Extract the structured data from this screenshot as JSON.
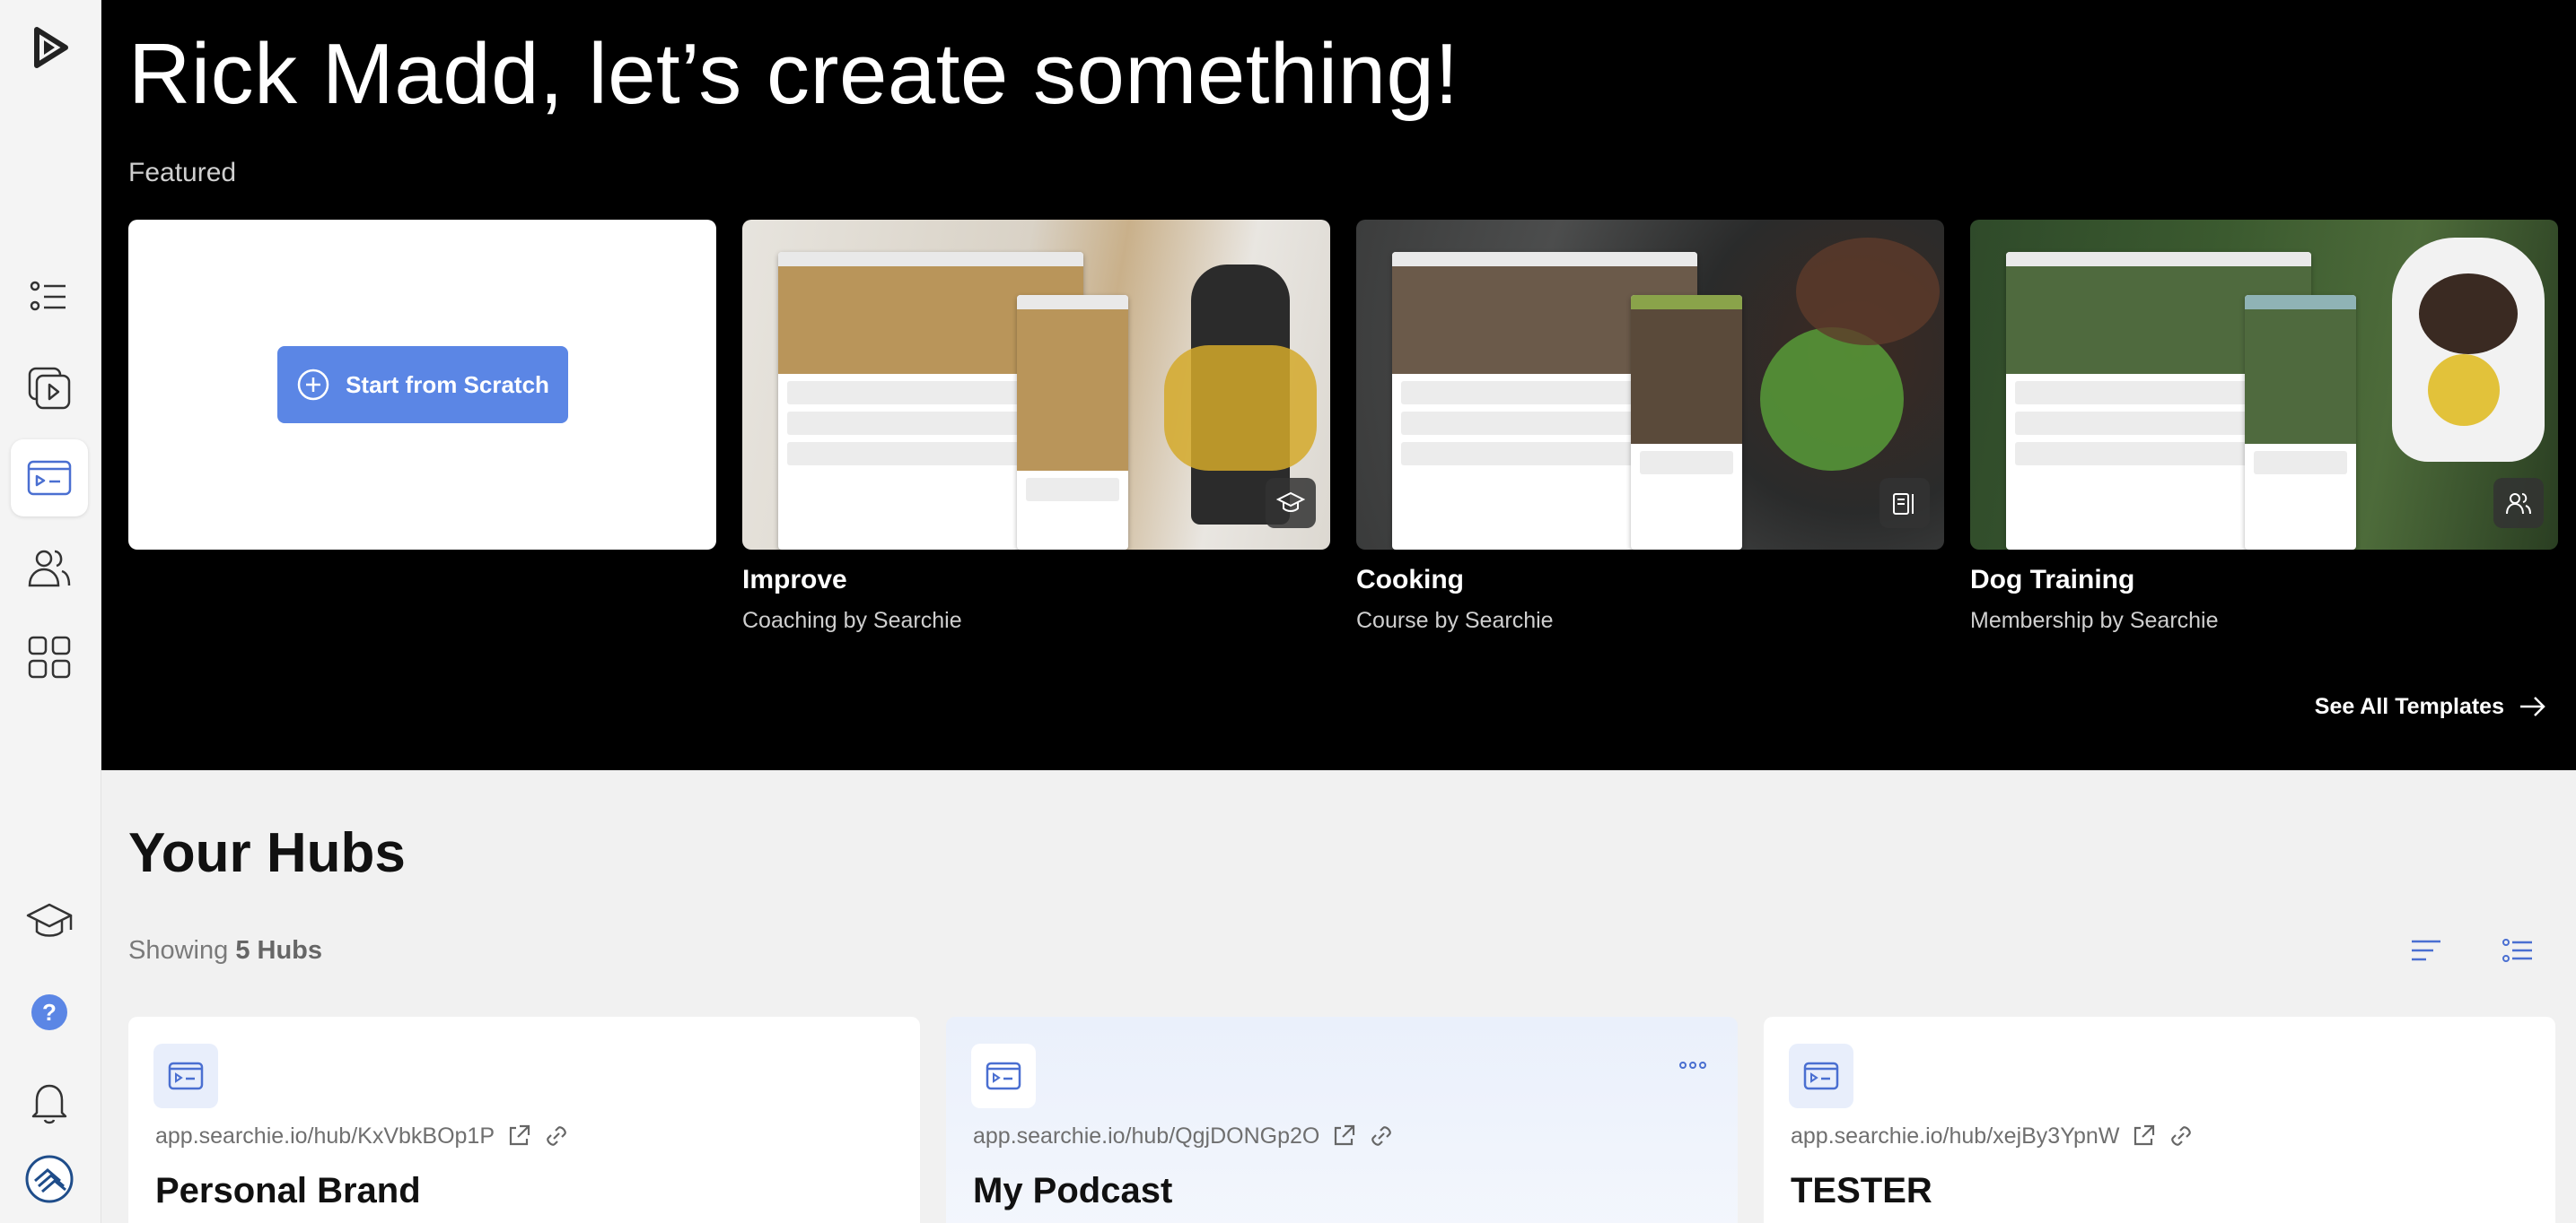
{
  "hero": {
    "title": "Rick Madd, let’s create something!",
    "featured_label": "Featured",
    "scratch_button": "Start from Scratch",
    "see_all": "See All Templates"
  },
  "templates": [
    {
      "name": "Improve",
      "subtitle": "Coaching by Searchie",
      "badge_icon": "graduation-cap-icon"
    },
    {
      "name": "Cooking",
      "subtitle": "Course by Searchie",
      "badge_icon": "recipe-book-icon"
    },
    {
      "name": "Dog Training",
      "subtitle": "Membership by Searchie",
      "badge_icon": "users-icon"
    }
  ],
  "hubs": {
    "title": "Your Hubs",
    "showing_prefix": "Showing ",
    "showing_count": "5 Hubs",
    "items": [
      {
        "url": "app.searchie.io/hub/KxVbkBOp1P",
        "name": "Personal Brand"
      },
      {
        "url": "app.searchie.io/hub/QgjDONGp2O",
        "name": "My Podcast"
      },
      {
        "url": "app.searchie.io/hub/xejBy3YpnW",
        "name": "TESTER"
      }
    ]
  },
  "colors": {
    "accent": "#5b86e5",
    "icon_blue": "#4a6fd1",
    "hero_bg": "#000000",
    "page_bg": "#f1f1f1"
  }
}
